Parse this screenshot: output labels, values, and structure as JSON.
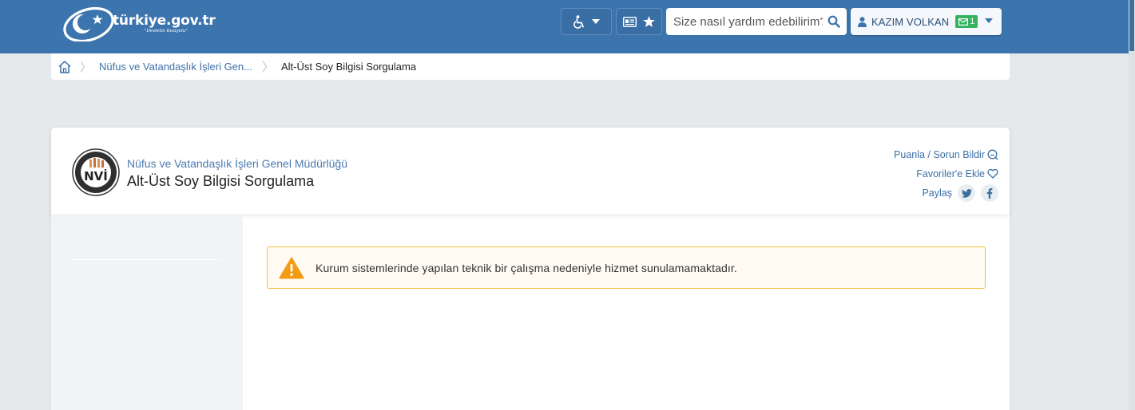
{
  "header": {
    "logo_text": "türkiye.gov.tr",
    "logo_slogan": "\"Devletin Kısayolu\"",
    "search_placeholder": "Size nasıl yardım edebilirim?",
    "user_name": "KAZIM VOLKAN",
    "message_count": "1",
    "brand_color": "#3c74ad",
    "icons": [
      "wheelchair-icon",
      "chevron-down-icon",
      "id-card-icon",
      "star-icon",
      "search-icon",
      "user-icon",
      "envelope-icon"
    ]
  },
  "breadcrumb": {
    "items": [
      {
        "label": "Nüfus ve Vatandaşlık İşleri Gen..."
      },
      {
        "label": "Alt-Üst Soy Bilgisi Sorgulama"
      }
    ]
  },
  "service": {
    "institution": "Nüfus ve Vatandaşlık İşleri Genel Müdürlüğü",
    "title": "Alt-Üst Soy Bilgisi Sorgulama",
    "seal_text": "NVİ",
    "actions": {
      "rate": "Puanla / Sorun Bildir",
      "favorite": "Favoriler'e Ekle",
      "share": "Paylaş"
    }
  },
  "alert": {
    "message": "Kurum sistemlerinde yapılan teknik bir çalışma nedeniyle hizmet sunulamamaktadır.",
    "color": "#f0c040"
  }
}
